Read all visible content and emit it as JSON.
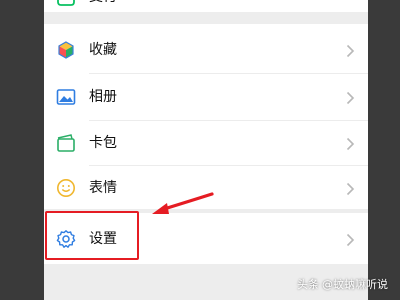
{
  "menu": {
    "top_partial": {
      "label": "支付",
      "icon": "payment-icon"
    },
    "items": [
      {
        "label": "收藏",
        "icon": "favorites-cube-icon"
      },
      {
        "label": "相册",
        "icon": "photo-album-icon"
      },
      {
        "label": "卡包",
        "icon": "card-wallet-icon"
      },
      {
        "label": "表情",
        "icon": "smiley-icon"
      }
    ],
    "settings": {
      "label": "设置",
      "icon": "gear-icon"
    }
  },
  "annotation": {
    "highlight_color": "#e51c23",
    "arrow_color": "#e51c23"
  },
  "watermark": {
    "logo_text": "头条",
    "handle": "@蚊蚋嘛听说"
  },
  "colors": {
    "page_background": "#ededed",
    "card_background": "#ffffff",
    "chevron": "#b8b8b8",
    "side_panels": "#3a3a3a"
  }
}
